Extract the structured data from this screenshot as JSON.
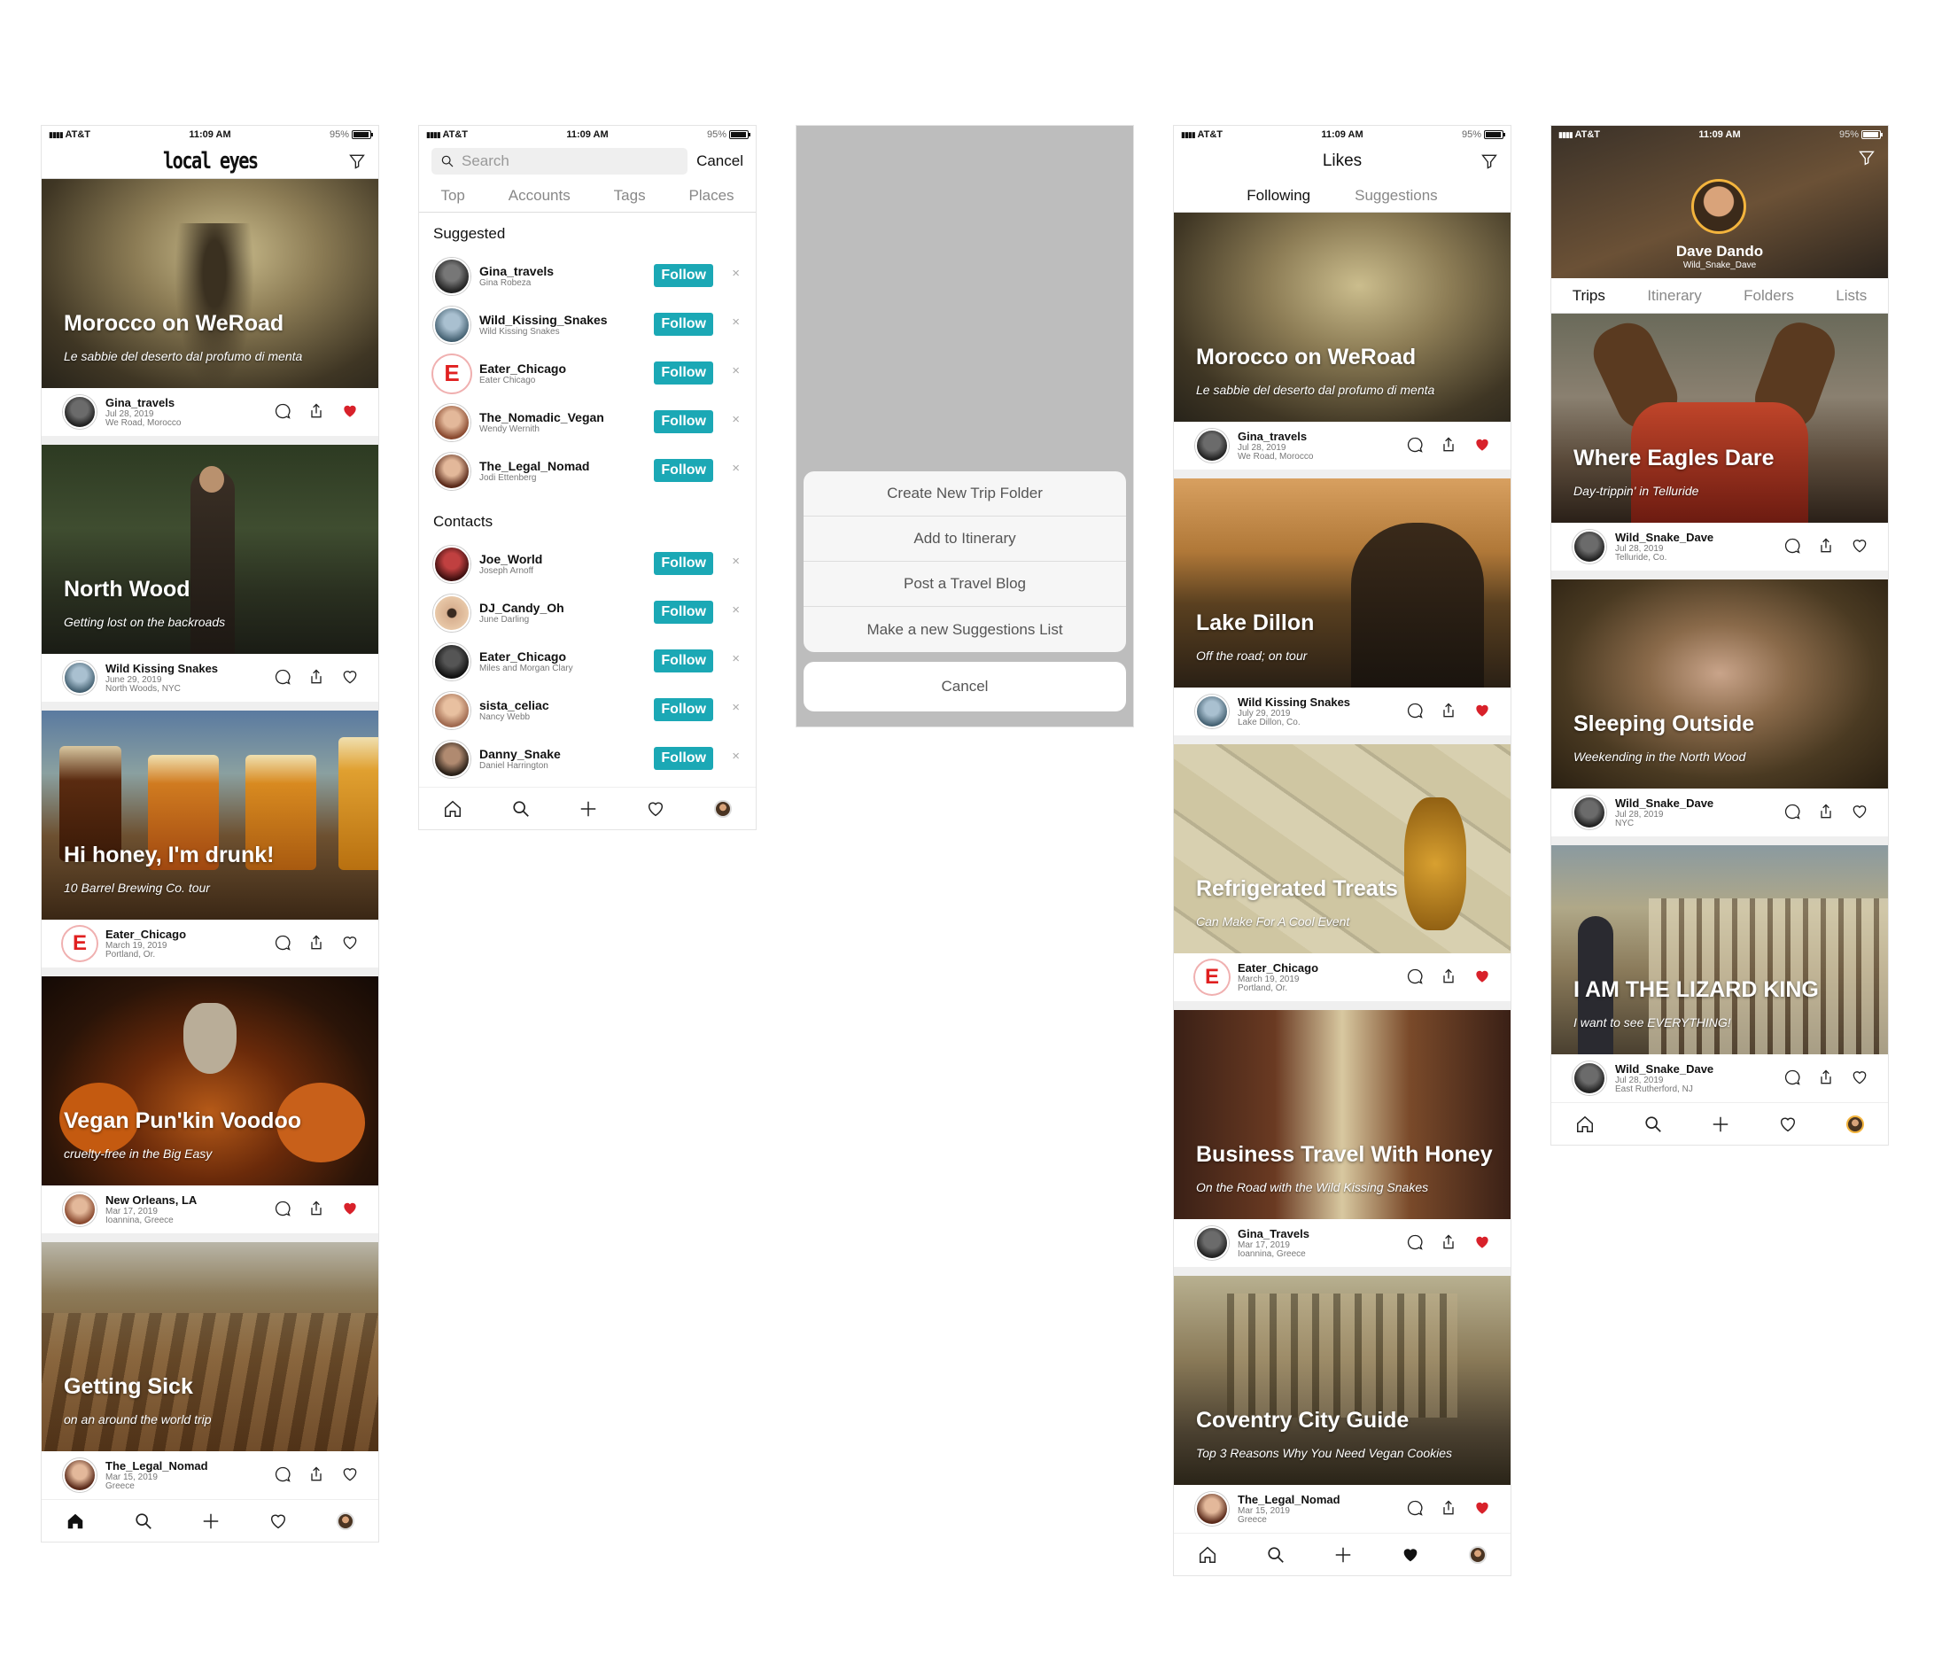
{
  "status": {
    "carrier": "AT&T",
    "time": "11:09 AM",
    "battery": "95%"
  },
  "app": {
    "logo": "local eyes"
  },
  "feed": {
    "posts": [
      {
        "title": "Morocco on WeRoad",
        "subtitle": "Le sabbie del deserto dal profumo di menta",
        "user": "Gina_travels",
        "date": "Jul 28, 2019",
        "place": "We Road, Morocco",
        "liked": true
      },
      {
        "title": "North Wood",
        "subtitle": "Getting lost on the backroads",
        "user": "Wild Kissing Snakes",
        "date": "June 29, 2019",
        "place": "North Woods, NYC",
        "liked": false
      },
      {
        "title": "Hi honey, I'm drunk!",
        "subtitle": "10 Barrel Brewing Co. tour",
        "user": "Eater_Chicago",
        "date": "March 19, 2019",
        "place": "Portland, Or.",
        "liked": false
      },
      {
        "title": "Vegan Pun'kin Voodoo",
        "subtitle": "cruelty-free in the Big Easy",
        "user": "New Orleans, LA",
        "date": "Mar 17, 2019",
        "place": "Ioannina, Greece",
        "liked": true
      },
      {
        "title": "Getting Sick",
        "subtitle": "on an around the world trip",
        "user": "The_Legal_Nomad",
        "date": "Mar 15, 2019",
        "place": "Greece",
        "liked": false
      }
    ]
  },
  "search": {
    "placeholder": "Search",
    "cancel": "Cancel",
    "tabs": [
      "Top",
      "Accounts",
      "Tags",
      "Places"
    ],
    "suggested_label": "Suggested",
    "suggested": [
      {
        "handle": "Gina_travels",
        "name": "Gina Robeza"
      },
      {
        "handle": "Wild_Kissing_Snakes",
        "name": "Wild Kissing Snakes"
      },
      {
        "handle": "Eater_Chicago",
        "name": "Eater Chicago"
      },
      {
        "handle": "The_Nomadic_Vegan",
        "name": "Wendy Wernith"
      },
      {
        "handle": "The_Legal_Nomad",
        "name": "Jodi Ettenberg"
      }
    ],
    "contacts_label": "Contacts",
    "contacts": [
      {
        "handle": "Joe_World",
        "name": "Joseph Arnoff"
      },
      {
        "handle": "DJ_Candy_Oh",
        "name": "June Darling"
      },
      {
        "handle": "Eater_Chicago",
        "name": "Miles and Morgan Clary"
      },
      {
        "handle": "sista_celiac",
        "name": "Nancy Webb"
      },
      {
        "handle": "Danny_Snake",
        "name": "Daniel Harrington"
      }
    ],
    "follow_label": "Follow",
    "dismiss": "×"
  },
  "sheet": {
    "options": [
      "Create New Trip Folder",
      "Add to Itinerary",
      "Post a Travel Blog",
      "Make a new Suggestions List"
    ],
    "cancel": "Cancel"
  },
  "likes": {
    "title": "Likes",
    "tabs": [
      "Following",
      "Suggestions"
    ],
    "posts": [
      {
        "title": "Morocco on WeRoad",
        "subtitle": "Le sabbie del deserto dal profumo di menta",
        "user": "Gina_travels",
        "date": "Jul 28, 2019",
        "place": "We Road, Morocco"
      },
      {
        "title": "Lake Dillon",
        "subtitle": "Off the road; on tour",
        "user": "Wild Kissing Snakes",
        "date": "July 29, 2019",
        "place": "Lake Dillon, Co."
      },
      {
        "title": "Refrigerated Treats",
        "subtitle": "Can Make For A Cool Event",
        "user": "Eater_Chicago",
        "date": "March 19, 2019",
        "place": "Portland, Or."
      },
      {
        "title": "Business Travel With Honey",
        "subtitle": "On the Road with the Wild Kissing Snakes",
        "user": "Gina_Travels",
        "date": "Mar 17, 2019",
        "place": "Ioannina, Greece"
      },
      {
        "title": "Coventry City Guide",
        "subtitle": "Top 3 Reasons Why You Need Vegan Cookies",
        "user": "The_Legal_Nomad",
        "date": "Mar 15, 2019",
        "place": "Greece"
      }
    ]
  },
  "profile": {
    "name": "Dave Dando",
    "handle": "Wild_Snake_Dave",
    "tabs": [
      "Trips",
      "Itinerary",
      "Folders",
      "Lists"
    ],
    "posts": [
      {
        "title": "Where Eagles Dare",
        "subtitle": "Day-trippin' in Telluride",
        "user": "Wild_Snake_Dave",
        "date": "Jul 28, 2019",
        "place": "Telluride, Co."
      },
      {
        "title": "Sleeping Outside",
        "subtitle": "Weekending in the North Wood",
        "user": "Wild_Snake_Dave",
        "date": "Jul 28, 2019",
        "place": "NYC"
      },
      {
        "title": "I AM THE LIZARD KING",
        "subtitle": "I want to see EVERYTHING!",
        "user": "Wild_Snake_Dave",
        "date": "Jul 28, 2019",
        "place": "East Rutherford, NJ"
      }
    ]
  },
  "colors": {
    "accent": "#1ba8b5",
    "heart": "#d8212a",
    "ring": "#f3b43d"
  }
}
